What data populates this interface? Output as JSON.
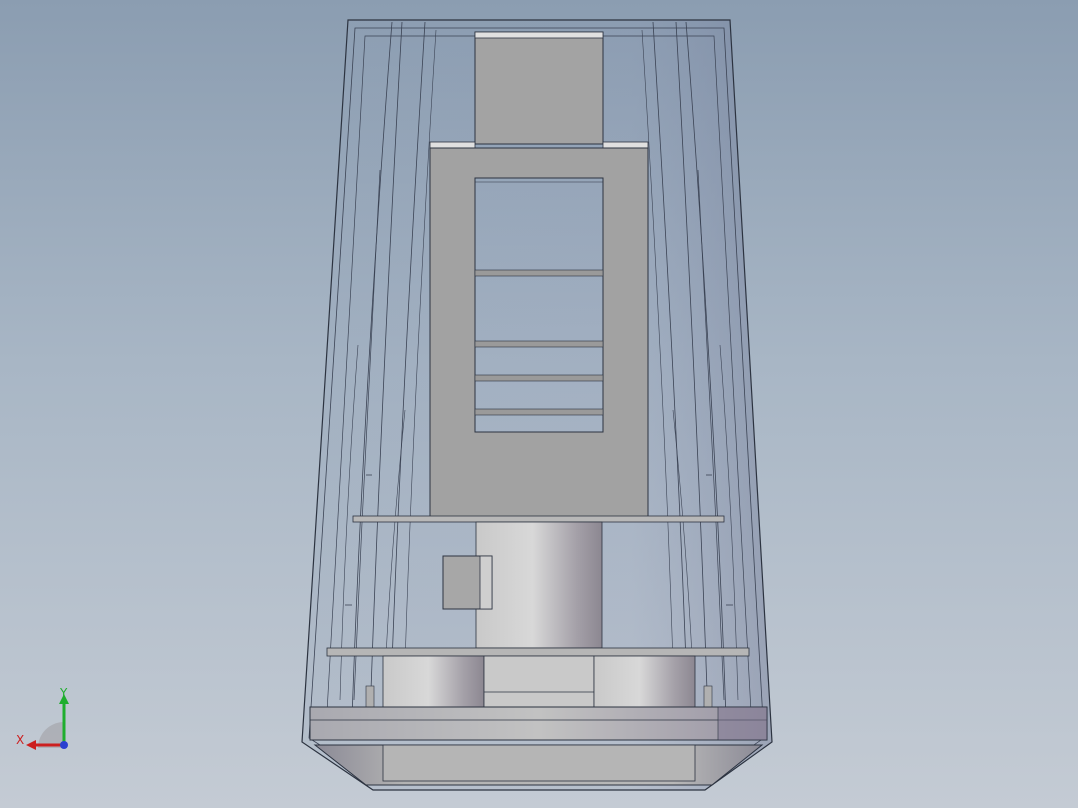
{
  "triad": {
    "x_label": "X",
    "y_label": "Y",
    "x_color": "#cc1f1f",
    "y_color": "#1fae2e",
    "z_color": "#2a3fd0"
  },
  "scene": {
    "background_top": "#8b9db1",
    "background_bottom": "#c4cbd4",
    "edge_color": "#2c3340",
    "part_color": "#a6a6a6"
  }
}
